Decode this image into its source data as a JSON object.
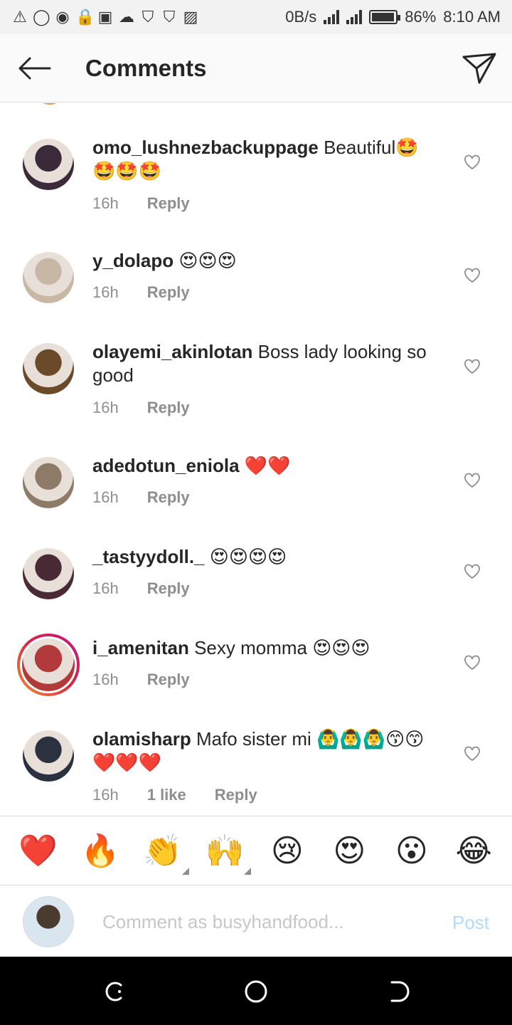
{
  "status_bar": {
    "left_icons": [
      "warning-icon",
      "whatsapp-icon",
      "app-icon",
      "lock-icon",
      "gallery-icon",
      "cloud-upload-icon",
      "shield-icon",
      "shield-icon",
      "activity-icon"
    ],
    "speed": "0B/s",
    "battery": "86%",
    "battery_level": 0.86,
    "time": "8:10 AM"
  },
  "header": {
    "title": "Comments"
  },
  "comments": [
    {
      "user": "omo_lushnezbackuppage",
      "text": "Beautiful🤩🤩🤩🤩",
      "time": "16h",
      "likes": "",
      "reply": "Reply",
      "avatar_color": "#3b2b3a"
    },
    {
      "user": "y_dolapo",
      "text": "😍😍😍",
      "time": "16h",
      "likes": "",
      "reply": "Reply",
      "avatar_color": "#c9b7a6"
    },
    {
      "user": "olayemi_akinlotan",
      "text": "Boss lady looking so good",
      "time": "16h",
      "likes": "",
      "reply": "Reply",
      "avatar_color": "#6b4a2a"
    },
    {
      "user": "adedotun_eniola",
      "text": "❤️❤️",
      "time": "16h",
      "likes": "",
      "reply": "Reply",
      "avatar_color": "#8d7b68"
    },
    {
      "user": "_tastyydoll._",
      "text": "😍😍😍😍",
      "time": "16h",
      "likes": "",
      "reply": "Reply",
      "avatar_color": "#4a2a35"
    },
    {
      "user": "i_amenitan",
      "text": "Sexy momma 😍😍😍",
      "time": "16h",
      "likes": "",
      "reply": "Reply",
      "avatar_color": "#b23a3a"
    },
    {
      "user": "olamisharp",
      "text": "Mafo sister mi 🙆‍♂️🙆‍♂️🙆‍♂️😙😙❤️❤️❤️",
      "time": "16h",
      "likes": "1 like",
      "reply": "Reply",
      "avatar_color": "#2c3140"
    }
  ],
  "emoji_bar": [
    "❤️",
    "🔥",
    "👏",
    "🙌",
    "😢",
    "😍",
    "😮",
    "😂"
  ],
  "input": {
    "placeholder": "Comment as busyhandfood...",
    "post_label": "Post"
  },
  "colors": {
    "accent": "#0095f6",
    "post_disabled": "#b3dbff",
    "heart_red": "#ed4956"
  }
}
